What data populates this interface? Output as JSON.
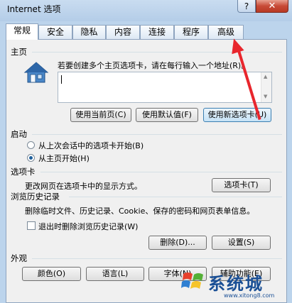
{
  "window": {
    "title": "Internet 选项",
    "help_label": "?",
    "close_label": "✕"
  },
  "tabs": [
    {
      "label": "常规",
      "active": true
    },
    {
      "label": "安全"
    },
    {
      "label": "隐私"
    },
    {
      "label": "内容"
    },
    {
      "label": "连接"
    },
    {
      "label": "程序"
    },
    {
      "label": "高级"
    }
  ],
  "homepage": {
    "label": "主页",
    "description": "若要创建多个主页选项卡，请在每行输入一个地址(R)。",
    "value": "",
    "buttons": {
      "use_current": "使用当前页(C)",
      "use_default": "使用默认值(F)",
      "use_new_tab": "使用新选项卡(U)"
    },
    "icon": "house-icon"
  },
  "startup": {
    "label": "启动",
    "options": [
      {
        "label": "从上次会话中的选项卡开始(B)",
        "selected": false
      },
      {
        "label": "从主页开始(H)",
        "selected": true
      }
    ]
  },
  "tabs_section": {
    "label": "选项卡",
    "description": "更改网页在选项卡中的显示方式。",
    "button": "选项卡(T)"
  },
  "history": {
    "label": "浏览历史记录",
    "description": "删除临时文件、历史记录、Cookie、保存的密码和网页表单信息。",
    "checkbox": {
      "label": "退出时删除浏览历史记录(W)",
      "checked": false
    },
    "delete_button": "删除(D)...",
    "settings_button": "设置(S)"
  },
  "appearance": {
    "label": "外观",
    "buttons": {
      "colors": "颜色(O)",
      "languages": "语言(L)",
      "fonts": "字体(N)",
      "accessibility": "辅助功能(E)"
    }
  },
  "watermark": {
    "text": "系统城",
    "url": "www.xitong8.com"
  },
  "colors": {
    "annotation_arrow": "#e8262d",
    "frame": "#bcd4ec"
  }
}
